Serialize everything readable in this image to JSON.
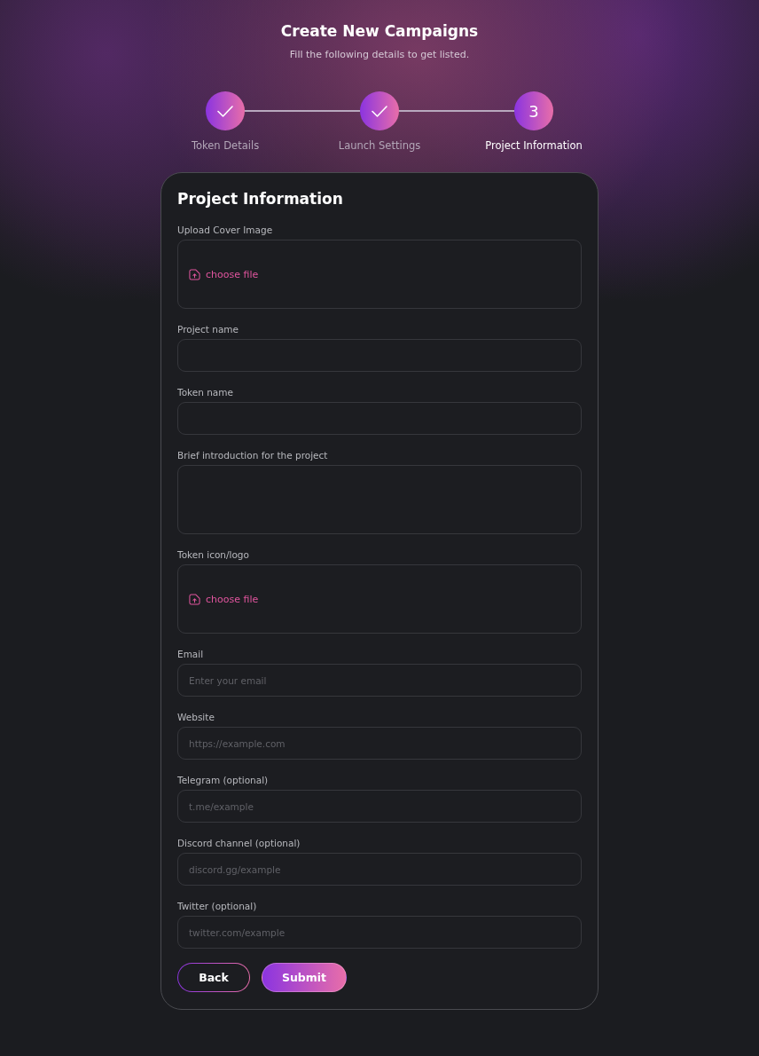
{
  "header": {
    "title": "Create New Campaigns",
    "subtitle": "Fill the following details to get listed."
  },
  "steps": [
    {
      "label": "Token Details",
      "done": true,
      "selected": false
    },
    {
      "label": "Launch Settings",
      "done": true,
      "selected": false
    },
    {
      "label": "Project Information",
      "number": "3",
      "done": false,
      "selected": true
    }
  ],
  "form": {
    "title": "Project Information",
    "fields": [
      {
        "kind": "upload",
        "label": "Upload Cover Image",
        "action": "choose file"
      },
      {
        "kind": "text",
        "label": "Project name"
      },
      {
        "kind": "text",
        "label": "Token name"
      },
      {
        "kind": "textarea",
        "label": "Brief introduction for the project"
      },
      {
        "kind": "upload",
        "label": "Token icon/logo",
        "action": "choose file"
      },
      {
        "kind": "text",
        "label": "Email",
        "placeholder": "Enter your email"
      },
      {
        "kind": "text",
        "label": "Website",
        "placeholder": "https://example.com"
      },
      {
        "kind": "text",
        "label": "Telegram (optional)",
        "placeholder": "t.me/example"
      },
      {
        "kind": "text",
        "label": "Discord channel (optional)",
        "placeholder": "discord.gg/example"
      },
      {
        "kind": "text",
        "label": "Twitter (optional)",
        "placeholder": "twitter.com/example"
      }
    ]
  },
  "buttons": [
    {
      "label": "Back",
      "kind": "outline"
    },
    {
      "label": "Submit",
      "kind": "primary"
    }
  ]
}
